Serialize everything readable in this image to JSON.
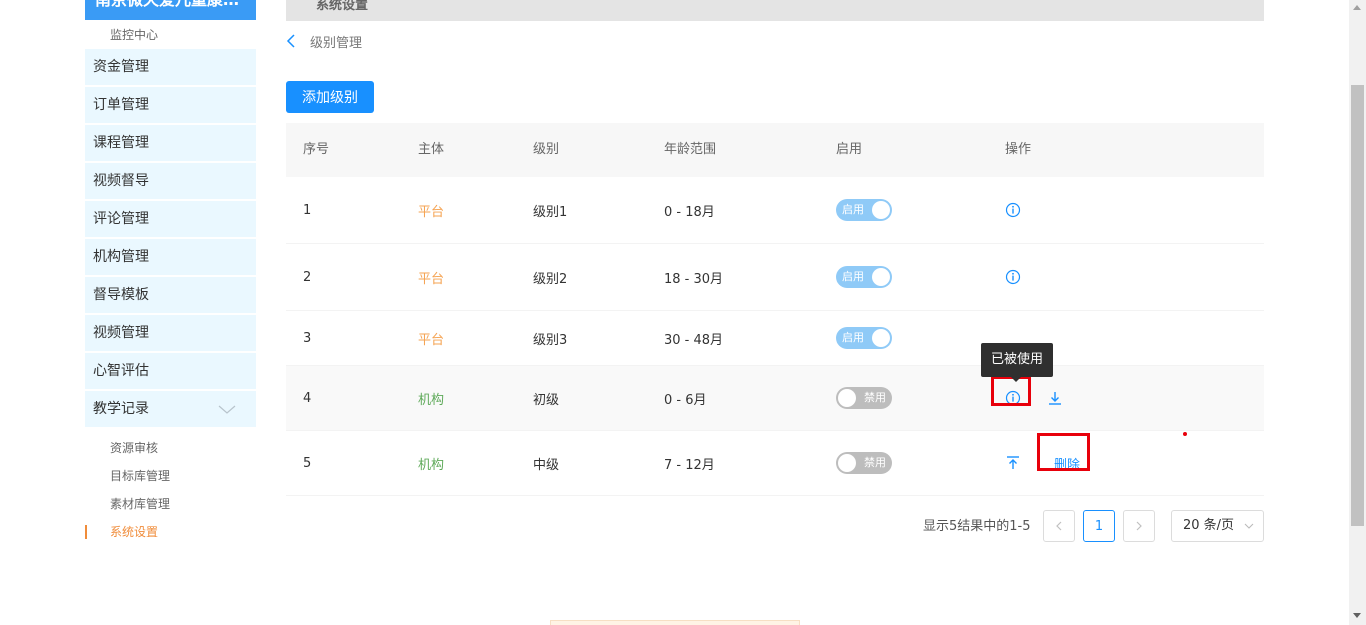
{
  "sidebar": {
    "brand": "南京微天爱儿童康…",
    "top_sub": "监控中心",
    "items": [
      {
        "label": "资金管理"
      },
      {
        "label": "订单管理"
      },
      {
        "label": "课程管理"
      },
      {
        "label": "视频督导"
      },
      {
        "label": "评论管理"
      },
      {
        "label": "机构管理"
      },
      {
        "label": "督导模板"
      },
      {
        "label": "视频管理"
      },
      {
        "label": "心智评估"
      },
      {
        "label": "教学记录",
        "expanded": true,
        "icon": "chevron-down-icon"
      }
    ],
    "subitems": [
      {
        "label": "资源审核"
      },
      {
        "label": "目标库管理"
      },
      {
        "label": "素材库管理"
      },
      {
        "label": "系统设置",
        "active": true
      }
    ],
    "active_color": "#f08c3a"
  },
  "topbar": {
    "title": "系统设置"
  },
  "breadcrumb": {
    "back_icon": "chevron-left-icon",
    "label": "级别管理"
  },
  "add_button": {
    "label": "添加级别",
    "color": "#1890ff"
  },
  "table": {
    "headers": [
      "序号",
      "主体",
      "级别",
      "年龄范围",
      "启用",
      "操作"
    ],
    "rows": [
      {
        "index": "1",
        "subject": "平台",
        "subject_type": "platform",
        "level": "级别1",
        "age": "0 - 18月",
        "enabled": true,
        "switch_label": "启用",
        "ops": [
          "info"
        ]
      },
      {
        "index": "2",
        "subject": "平台",
        "subject_type": "platform",
        "level": "级别2",
        "age": "18 - 30月",
        "enabled": true,
        "switch_label": "启用",
        "ops": [
          "info"
        ]
      },
      {
        "index": "3",
        "subject": "平台",
        "subject_type": "platform",
        "level": "级别3",
        "age": "30 - 48月",
        "enabled": true,
        "switch_label": "启用",
        "ops": []
      },
      {
        "index": "4",
        "subject": "机构",
        "subject_type": "org",
        "level": "初级",
        "age": "0 - 6月",
        "enabled": false,
        "switch_label": "禁用",
        "ops": [
          "info",
          "move-down"
        ]
      },
      {
        "index": "5",
        "subject": "机构",
        "subject_type": "org",
        "level": "中级",
        "age": "7 - 12月",
        "enabled": false,
        "switch_label": "禁用",
        "ops": [
          "move-up",
          "delete"
        ]
      }
    ],
    "delete_label": "删除",
    "colors": {
      "platform": "#f5a352",
      "org": "#5faa5a"
    }
  },
  "tooltip": {
    "text": "已被使用"
  },
  "pagination": {
    "summary": "显示5结果中的1-5",
    "current_page": "1",
    "page_size": "20 条/页"
  }
}
